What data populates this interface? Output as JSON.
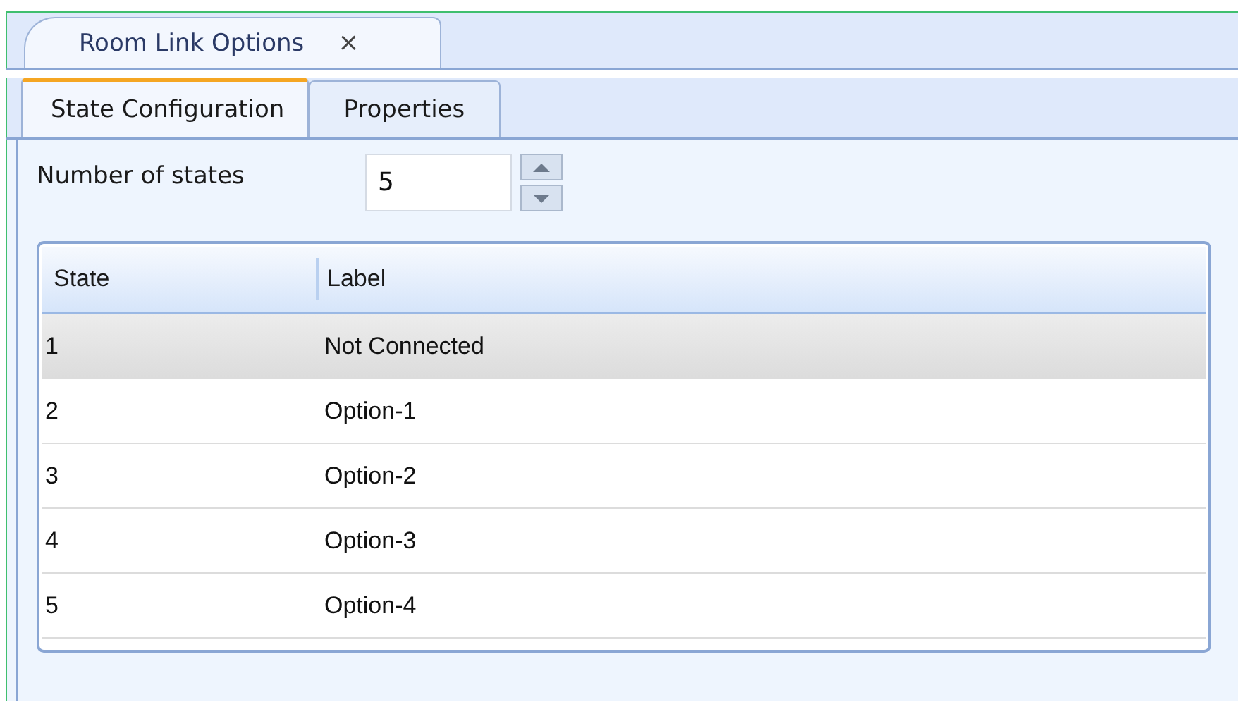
{
  "document_tab": {
    "title": "Room Link Options",
    "close": "×"
  },
  "tabs": [
    {
      "label": "State Configuration",
      "selected": true
    },
    {
      "label": "Properties",
      "selected": false
    }
  ],
  "number_of_states": {
    "label": "Number of states",
    "value": "5"
  },
  "table": {
    "columns": [
      "State",
      "Label"
    ],
    "rows": [
      {
        "state": "1",
        "label": "Not Connected",
        "selected": true
      },
      {
        "state": "2",
        "label": "Option-1",
        "selected": false
      },
      {
        "state": "3",
        "label": "Option-2",
        "selected": false
      },
      {
        "state": "4",
        "label": "Option-3",
        "selected": false
      },
      {
        "state": "5",
        "label": "Option-4",
        "selected": false
      }
    ]
  }
}
